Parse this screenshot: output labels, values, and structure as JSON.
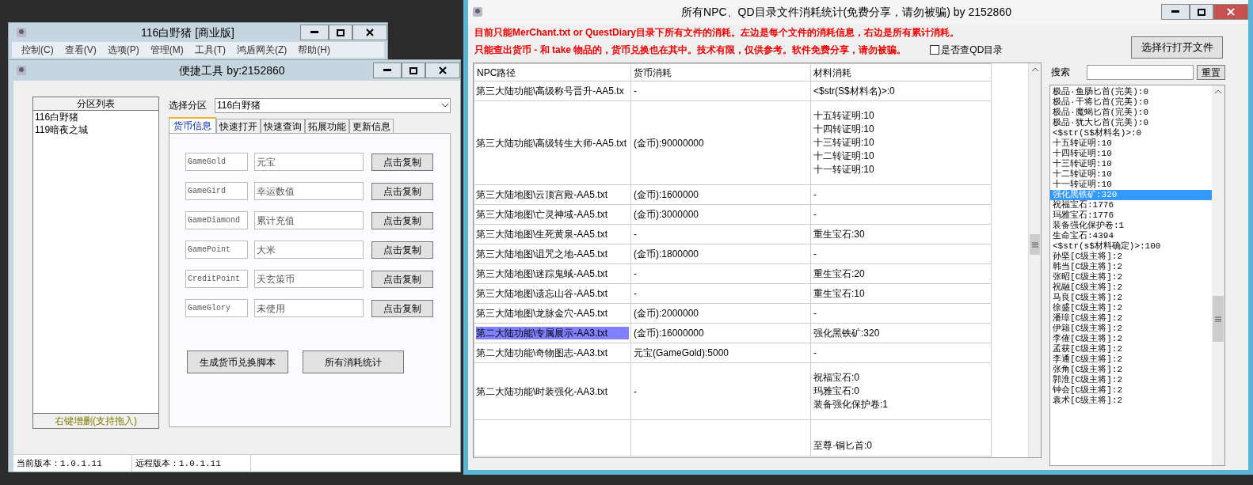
{
  "main_window": {
    "title": "116白野猪 [商业版]",
    "menu": [
      "控制(C)",
      "查看(V)",
      "选项(P)",
      "管理(M)",
      "工具(T)",
      "鸿盾网关(Z)",
      "帮助(H)"
    ]
  },
  "tool_window": {
    "title": "便捷工具  by:2152860",
    "partition_list": {
      "header": "分区列表",
      "items": [
        {
          "label": "116白野猪"
        },
        {
          "label": "119暗夜之城"
        }
      ],
      "footer": "右键增删(支持拖入)"
    },
    "partition_select": {
      "label": "选择分区",
      "value": "116白野猪"
    },
    "tabs": [
      {
        "label": "货币信息",
        "selected": true
      },
      {
        "label": "快速打开",
        "selected": false
      },
      {
        "label": "快速查询",
        "selected": false
      },
      {
        "label": "拓展功能",
        "selected": false
      },
      {
        "label": "更新信息",
        "selected": false
      }
    ],
    "currencies": [
      {
        "key": "GameGold",
        "name": "元宝",
        "button": "点击复制"
      },
      {
        "key": "GameGird",
        "name": "幸运数值",
        "button": "点击复制"
      },
      {
        "key": "GameDiamond",
        "name": "累计充值",
        "button": "点击复制"
      },
      {
        "key": "GamePoint",
        "name": "大米",
        "button": "点击复制"
      },
      {
        "key": "CreditPoint",
        "name": "天玄策币",
        "button": "点击复制"
      },
      {
        "key": "GameGlory",
        "name": "未使用",
        "button": "点击复制"
      }
    ],
    "buttons": [
      "生成货币兑换脚本",
      "所有消耗统计"
    ],
    "status_bar": [
      "当前版本：1.0.1.11",
      "远程版本：1.0.1.11"
    ]
  },
  "stats_window": {
    "title": "所有NPC、QD目录文件消耗统计(免费分享，请勿被骗)     by 2152860",
    "notices": [
      "目前只能MerChant.txt or QuestDiary目录下所有文件的消耗。左边是每个文件的消耗信息，右边是所有累计消耗。",
      "只能查出货币 - 和 take 物品的，货币兑换也在其中。技术有限，仅供参考。软件免费分享，请勿被骗。"
    ],
    "qd_checkbox": {
      "label": "是否查QD目录",
      "checked": false
    },
    "open_button": "选择行打开文件",
    "table": {
      "columns": [
        "NPC路径",
        "货币消耗",
        "材料消耗"
      ],
      "rows": [
        {
          "path": "第三大陆功能\\高级称号晋升-AA5.tx",
          "currency": "-",
          "materials": [
            "<$str(S$材料名)>:0"
          ],
          "selected": false
        },
        {
          "path": "第三大陆功能\\高级转生大师-AA5.txt",
          "currency": "(金币):90000000",
          "materials": [
            "十五转证明:10",
            "十四转证明:10",
            "十三转证明:10",
            "十二转证明:10",
            "十一转证明:10"
          ],
          "selected": false
        },
        {
          "path": "第三大陆地图\\云顶宫殿-AA5.txt",
          "currency": "(金币):1600000",
          "materials": [
            "-"
          ],
          "selected": false
        },
        {
          "path": "第三大陆地图\\亡灵神域-AA5.txt",
          "currency": "(金币):3000000",
          "materials": [
            "-"
          ],
          "selected": false
        },
        {
          "path": "第三大陆地图\\生死黄泉-AA5.txt",
          "currency": "-",
          "materials": [
            "重生宝石:30"
          ],
          "selected": false
        },
        {
          "path": "第三大陆地图\\诅咒之地-AA5.txt",
          "currency": "(金币):1800000",
          "materials": [
            "-"
          ],
          "selected": false
        },
        {
          "path": "第三大陆地图\\迷踪鬼蜮-AA5.txt",
          "currency": "-",
          "materials": [
            "重生宝石:20"
          ],
          "selected": false
        },
        {
          "path": "第三大陆地图\\遗忘山谷-AA5.txt",
          "currency": "-",
          "materials": [
            "重生宝石:10"
          ],
          "selected": false
        },
        {
          "path": "第三大陆地图\\龙脉金穴-AA5.txt",
          "currency": "(金币):2000000",
          "materials": [
            "-"
          ],
          "selected": false
        },
        {
          "path": "第二大陆功能\\专属展示-AA3.txt",
          "currency": "(金币):16000000",
          "materials": [
            "强化黑铁矿:320"
          ],
          "selected": true
        },
        {
          "path": "第二大陆功能\\奇物图志-AA3.txt",
          "currency": "元宝(GameGold):5000",
          "materials": [
            "-"
          ],
          "selected": false
        },
        {
          "path": "第二大陆功能\\时装强化-AA3.txt",
          "currency": "-",
          "materials": [
            "祝福宝石:0",
            "玛雅宝石:0",
            "装备强化保护卷:1"
          ],
          "selected": false
        },
        {
          "path": "",
          "currency": "",
          "materials": [
            "至尊·铜匕首:0"
          ],
          "selected": false
        }
      ]
    },
    "search": {
      "label": "搜索",
      "button": "重置"
    },
    "totals": [
      {
        "text": "极品·鱼肠匕首(完美):0",
        "selected": false
      },
      {
        "text": "极品·干将匕首(完美):0",
        "selected": false
      },
      {
        "text": "极品·魔蝎匕首(完美):0",
        "selected": false
      },
      {
        "text": "极品·犹大匕首(完美):0",
        "selected": false
      },
      {
        "text": "<$str(S$材料名)>:0",
        "selected": false
      },
      {
        "text": "十五转证明:10",
        "selected": false
      },
      {
        "text": "十四转证明:10",
        "selected": false
      },
      {
        "text": "十三转证明:10",
        "selected": false
      },
      {
        "text": "十二转证明:10",
        "selected": false
      },
      {
        "text": "十一转证明:10",
        "selected": false
      },
      {
        "text": "强化黑铁矿:320",
        "selected": true
      },
      {
        "text": "祝福宝石:1776",
        "selected": false
      },
      {
        "text": "玛雅宝石:1776",
        "selected": false
      },
      {
        "text": "装备强化保护卷:1",
        "selected": false
      },
      {
        "text": "生命宝石:4394",
        "selected": false
      },
      {
        "text": "<$str(s$材料确定)>:100",
        "selected": false
      },
      {
        "text": "孙坚[C级主将]:2",
        "selected": false
      },
      {
        "text": "韩当[C级主将]:2",
        "selected": false
      },
      {
        "text": "张昭[C级主将]:2",
        "selected": false
      },
      {
        "text": "祝融[C级主将]:2",
        "selected": false
      },
      {
        "text": "马良[C级主将]:2",
        "selected": false
      },
      {
        "text": "徐盛[C级主将]:2",
        "selected": false
      },
      {
        "text": "潘璋[C级主将]:2",
        "selected": false
      },
      {
        "text": "伊籍[C级主将]:2",
        "selected": false
      },
      {
        "text": "李傕[C级主将]:2",
        "selected": false
      },
      {
        "text": "孟获[C级主将]:2",
        "selected": false
      },
      {
        "text": "李通[C级主将]:2",
        "selected": false
      },
      {
        "text": "张角[C级主将]:2",
        "selected": false
      },
      {
        "text": "郭淮[C级主将]:2",
        "selected": false
      },
      {
        "text": "钟会[C级主将]:2",
        "selected": false
      },
      {
        "text": "袁术[C级主将]:2",
        "selected": false
      }
    ]
  }
}
